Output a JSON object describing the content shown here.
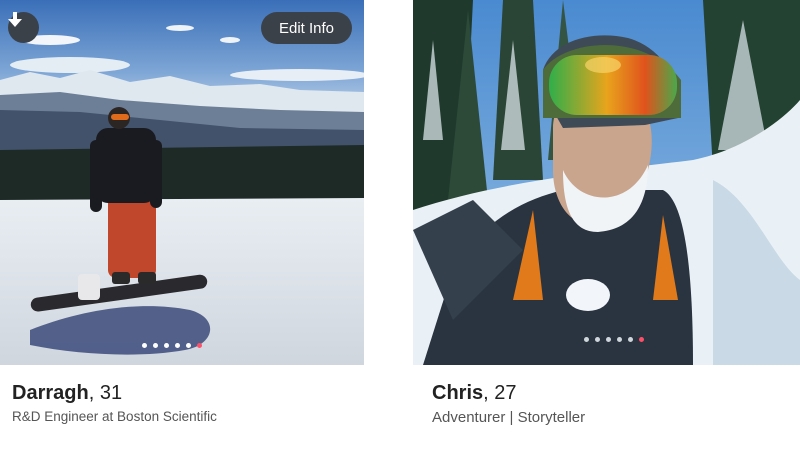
{
  "profiles": [
    {
      "name": "Darragh",
      "age": "31",
      "subtitle": "R&D Engineer at Boston Scientific",
      "photo_dots": 6,
      "active_dot": 6,
      "buttons": {
        "download_icon": "download-arrow-icon",
        "edit_label": "Edit Info"
      }
    },
    {
      "name": "Chris",
      "age": "27",
      "subtitle": "Adventurer | Storyteller",
      "photo_dots": 6,
      "active_dot": 6
    }
  ],
  "colors": {
    "accent": "#fd5068",
    "button_bg": "#3b4148"
  }
}
